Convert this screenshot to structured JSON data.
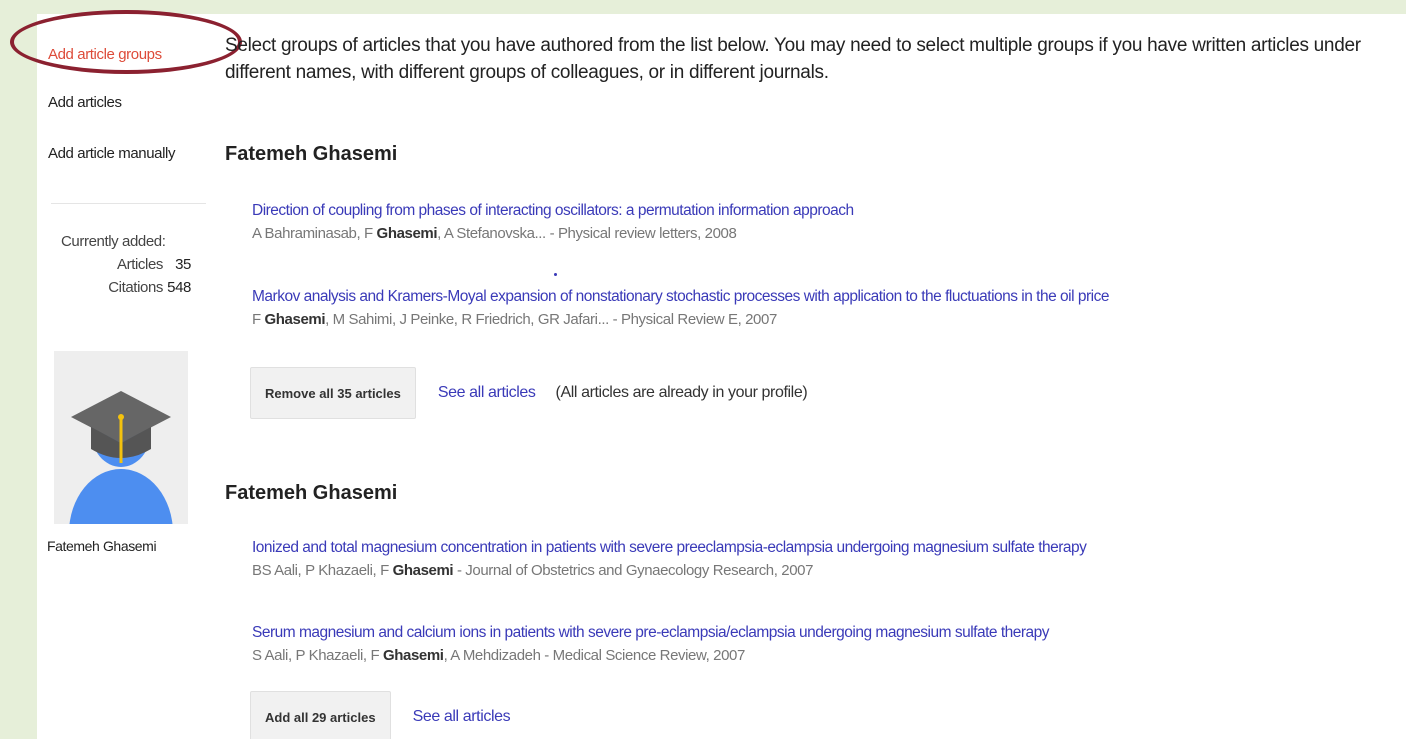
{
  "sidebar": {
    "nav": [
      {
        "label": "Add article groups",
        "active": true
      },
      {
        "label": "Add articles",
        "active": false
      },
      {
        "label": "Add article manually",
        "active": false
      }
    ],
    "stats": {
      "heading": "Currently added:",
      "articles_label": "Articles",
      "articles_value": "35",
      "citations_label": "Citations",
      "citations_value": "548"
    },
    "profile_name": "Fatemeh Ghasemi"
  },
  "main": {
    "intro": "Select groups of articles that you have authored from the list below. You may need to select multiple groups if you have written articles under different names, with different groups of colleagues, or in different journals.",
    "groups": [
      {
        "author": "Fatemeh Ghasemi",
        "articles": [
          {
            "title": "Direction of coupling from phases of interacting oscillators: a permutation information approach",
            "meta_before": "A Bahraminasab, F ",
            "meta_bold": "Ghasemi",
            "meta_after": ", A Stefanovska... - Physical review letters, 2008"
          },
          {
            "title": "Markov analysis and Kramers-Moyal expansion of nonstationary stochastic processes with application to the fluctuations in the oil price",
            "meta_before": "F ",
            "meta_bold": "Ghasemi",
            "meta_after": ", M Sahimi, J Peinke, R Friedrich, GR Jafari... - Physical Review E, 2007"
          }
        ],
        "button_label": "Remove all 35 articles",
        "see_all_label": "See all articles",
        "note": "(All articles are already in your profile)"
      },
      {
        "author": "Fatemeh Ghasemi",
        "articles": [
          {
            "title": "Ionized and total magnesium concentration in patients with severe preeclampsia-eclampsia undergoing magnesium sulfate therapy",
            "meta_before": "BS Aali, P Khazaeli, F ",
            "meta_bold": "Ghasemi",
            "meta_after": " - Journal of Obstetrics and Gynaecology Research, 2007"
          },
          {
            "title": "Serum magnesium and calcium ions in patients with severe pre-eclampsia/eclampsia undergoing magnesium sulfate therapy",
            "meta_before": "S Aali, P Khazaeli, F ",
            "meta_bold": "Ghasemi",
            "meta_after": ", A Mehdizadeh - Medical Science Review, 2007"
          }
        ],
        "button_label": "Add all 29 articles",
        "see_all_label": "See all articles"
      }
    ]
  },
  "colors": {
    "page_background": "#e6efd9",
    "active_link": "#dd4b39",
    "link": "#3a3ab8",
    "highlight_oval": "#8b2130",
    "avatar_blue": "#4d8ef0",
    "cap_gray": "#666666",
    "tassel_yellow": "#f4c20d"
  },
  "icons": {
    "avatar": "graduate-avatar-icon"
  }
}
